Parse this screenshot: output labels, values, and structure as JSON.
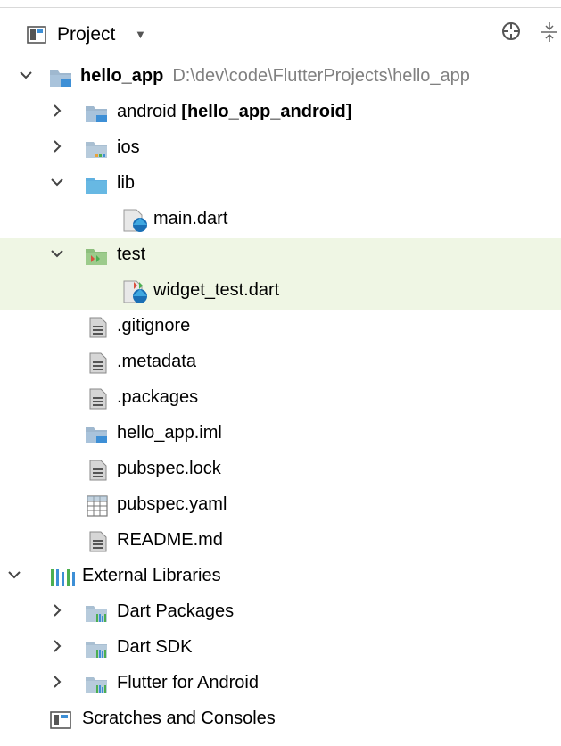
{
  "header": {
    "title": "Project"
  },
  "tree": {
    "root": {
      "name": "hello_app",
      "path": "D:\\dev\\code\\FlutterProjects\\hello_app"
    },
    "android": {
      "name": "android",
      "module": "[hello_app_android]"
    },
    "ios": "ios",
    "lib": "lib",
    "main": "main.dart",
    "test": "test",
    "widget_test": "widget_test.dart",
    "gitignore": ".gitignore",
    "metadata": ".metadata",
    "packages": ".packages",
    "iml": "hello_app.iml",
    "pubspec_lock": "pubspec.lock",
    "pubspec_yaml": "pubspec.yaml",
    "readme": "README.md",
    "external": "External Libraries",
    "dart_packages": "Dart Packages",
    "dart_sdk": "Dart SDK",
    "flutter_android": "Flutter for Android",
    "scratches": "Scratches and Consoles"
  },
  "colors": {
    "selection_bg": "#eff6e4",
    "folder_blue": "#67b8e3",
    "module_blue": "#3d8fd6",
    "path_gray": "#808080"
  },
  "icons": {
    "collapsed": "chevron-right-icon",
    "expanded": "chevron-down-icon",
    "folder": "folder-icon",
    "module": "module-folder-icon",
    "dart": "dart-file-icon",
    "text": "text-file-icon",
    "yaml": "yaml-file-icon",
    "library": "library-icon"
  }
}
